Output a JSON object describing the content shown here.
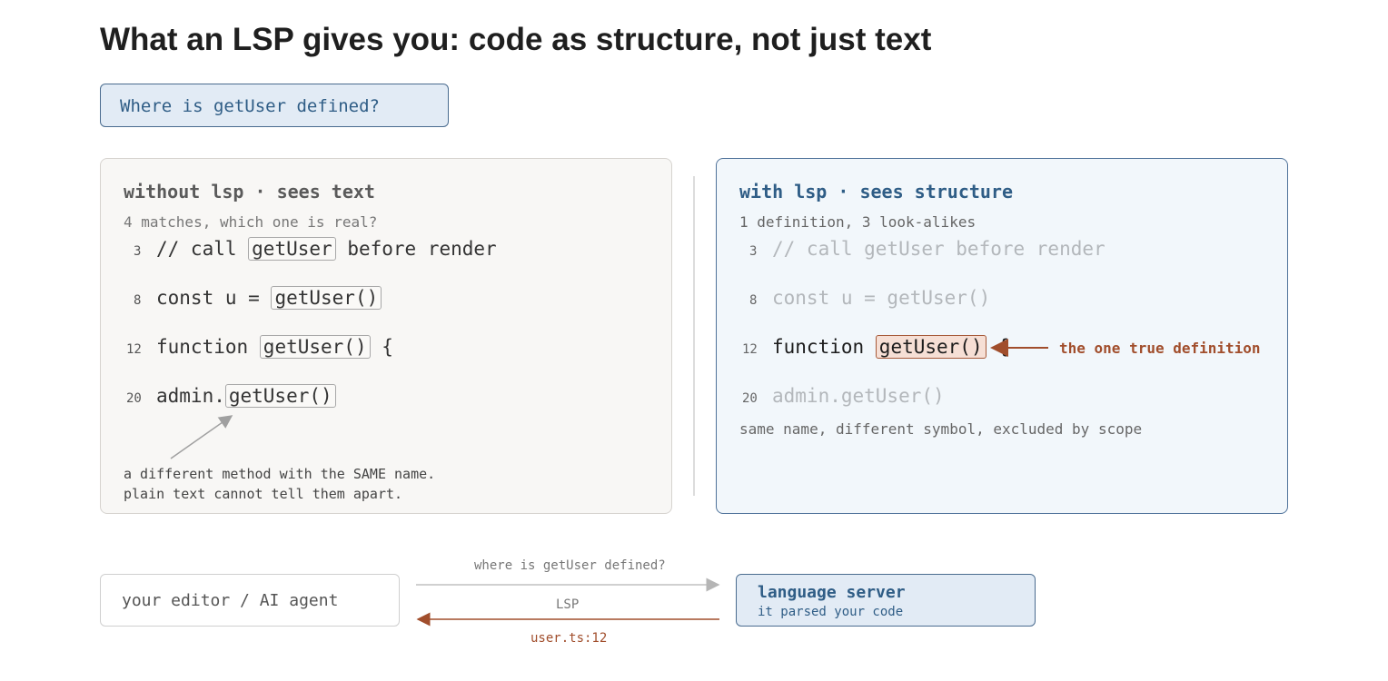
{
  "title": "What an LSP gives you: code as structure, not just text",
  "query": "Where is getUser defined?",
  "left_panel": {
    "title": "without lsp · sees text",
    "subtitle": "4 matches, which one is real?",
    "lines": [
      {
        "num": "3",
        "before": "// call ",
        "match": "getUser",
        "after": " before render"
      },
      {
        "num": "8",
        "before": "const u = ",
        "match": "getUser()",
        "after": ""
      },
      {
        "num": "12",
        "before": "function ",
        "match": "getUser()",
        "after": " {"
      },
      {
        "num": "20",
        "before": "admin.",
        "match": "getUser()",
        "after": ""
      }
    ],
    "note_line1": "a different method with the SAME name.",
    "note_line2": "plain text cannot tell them apart."
  },
  "right_panel": {
    "title": "with lsp · sees structure",
    "subtitle": "1 definition, 3 look-alikes",
    "lines": [
      {
        "num": "3",
        "text": "// call getUser before render"
      },
      {
        "num": "8",
        "text": "const u = getUser()"
      },
      {
        "num": "12",
        "before": "function ",
        "match": "getUser()",
        "after": " {"
      },
      {
        "num": "20",
        "text": "admin.getUser()"
      }
    ],
    "annotation": "the one true definition",
    "note": "same name, different symbol, excluded by scope"
  },
  "flow": {
    "editor_label": "your editor / AI agent",
    "server_title": "language server",
    "server_subtitle": "it parsed your code",
    "request": "where is getUser defined?",
    "protocol": "LSP",
    "response": "user.ts:12"
  },
  "colors": {
    "accent_blue": "#2f5d86",
    "accent_rust": "#a14e2c",
    "highlight_fill": "#f6dfd5"
  }
}
